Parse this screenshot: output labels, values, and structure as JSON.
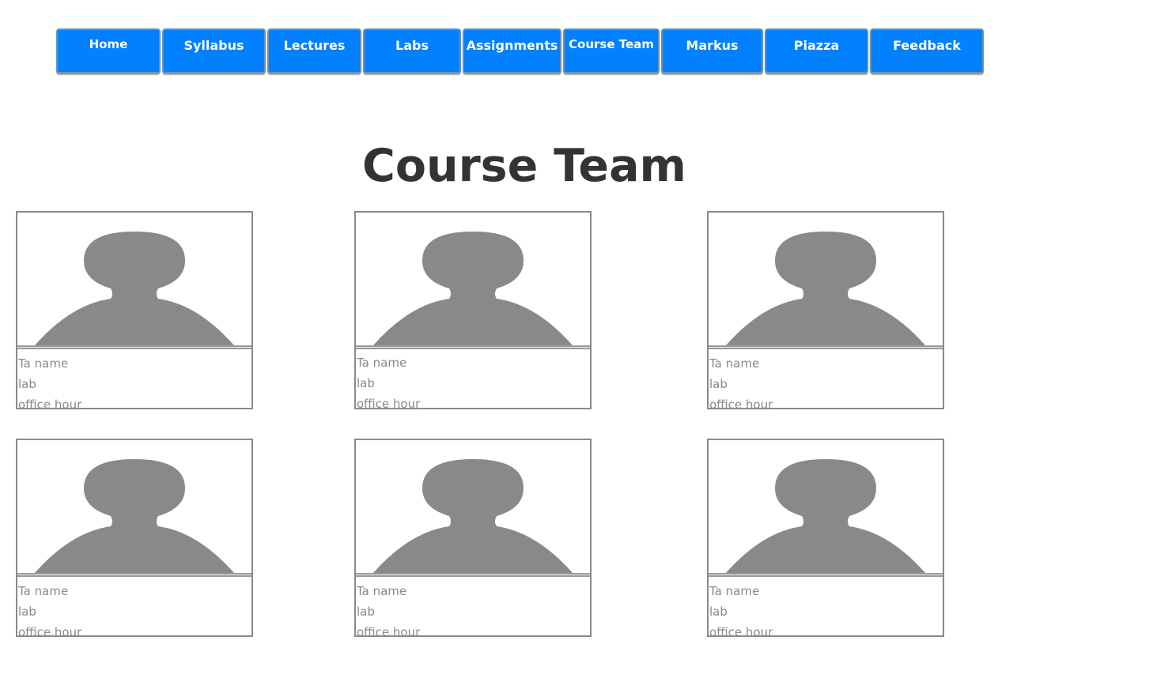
{
  "nav": {
    "items": [
      {
        "label": "Home"
      },
      {
        "label": "Syllabus"
      },
      {
        "label": "Lectures"
      },
      {
        "label": "Labs"
      },
      {
        "label": "Assignments"
      },
      {
        "label": "Course Team"
      },
      {
        "label": "Markus"
      },
      {
        "label": "Piazza"
      },
      {
        "label": "Feedback"
      }
    ],
    "button_color": "#0180ff"
  },
  "page": {
    "title": "Course Team"
  },
  "team": {
    "members": [
      {
        "name": "Ta name",
        "lab": "lab",
        "office_hour": "office hour",
        "avatar_icon": "person-silhouette-icon"
      },
      {
        "name": "Ta name",
        "lab": "lab",
        "office_hour": "office hour",
        "avatar_icon": "person-silhouette-icon"
      },
      {
        "name": "Ta name",
        "lab": "lab",
        "office_hour": "office hour",
        "avatar_icon": "person-silhouette-icon"
      },
      {
        "name": "Ta name",
        "lab": "lab",
        "office_hour": "office hour",
        "avatar_icon": "person-silhouette-icon"
      },
      {
        "name": "Ta name",
        "lab": "lab",
        "office_hour": "office hour",
        "avatar_icon": "person-silhouette-icon"
      },
      {
        "name": "Ta name",
        "lab": "lab",
        "office_hour": "office hour",
        "avatar_icon": "person-silhouette-icon"
      }
    ],
    "silhouette_color": "#898989"
  }
}
